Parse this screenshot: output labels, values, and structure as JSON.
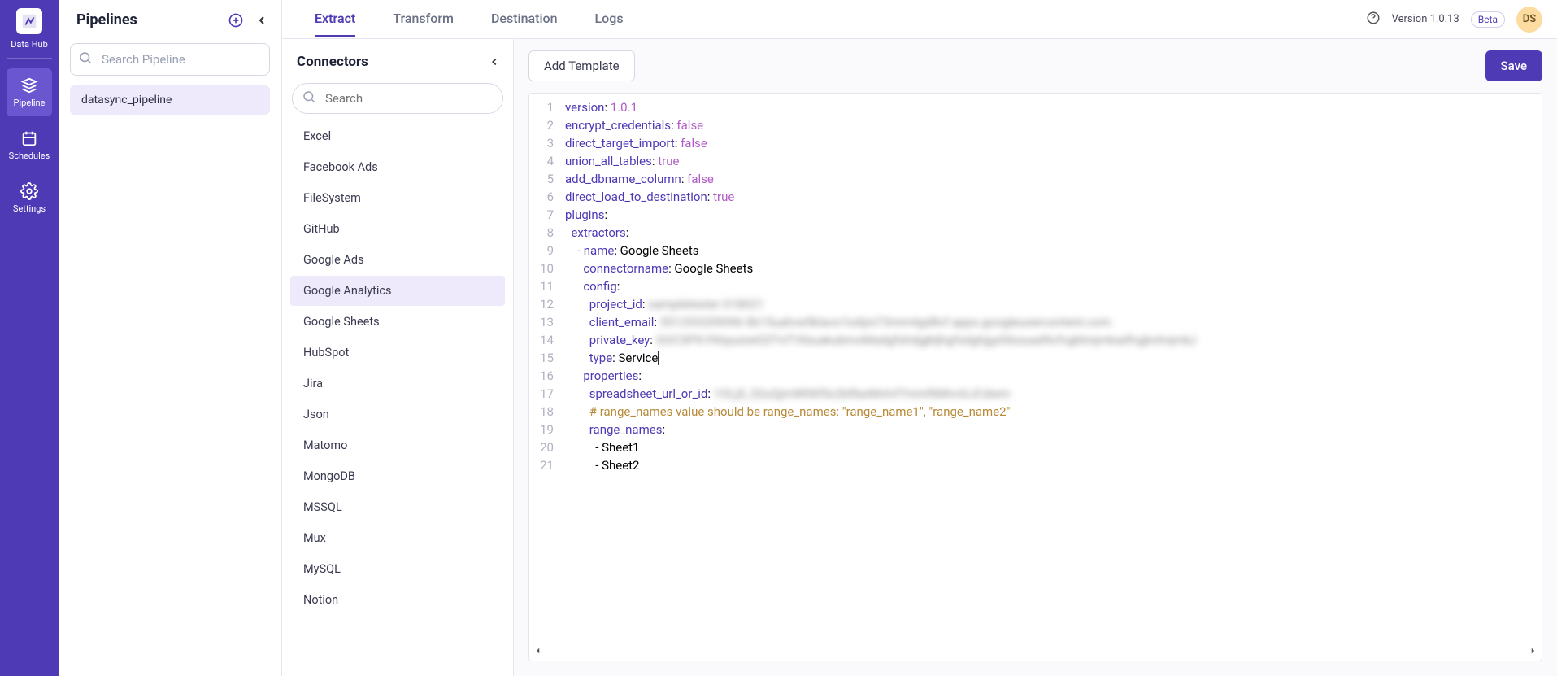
{
  "brand": {
    "label": "Data Hub"
  },
  "nav": {
    "items": [
      {
        "label": "Pipeline",
        "active": true
      },
      {
        "label": "Schedules",
        "active": false
      },
      {
        "label": "Settings",
        "active": false
      }
    ]
  },
  "pipelines": {
    "title": "Pipelines",
    "search_placeholder": "Search Pipeline",
    "items": [
      {
        "name": "datasync_pipeline"
      }
    ]
  },
  "tabs": [
    {
      "label": "Extract",
      "active": true
    },
    {
      "label": "Transform",
      "active": false
    },
    {
      "label": "Destination",
      "active": false
    },
    {
      "label": "Logs",
      "active": false
    }
  ],
  "header": {
    "version": "Version 1.0.13",
    "beta": "Beta",
    "avatar": "DS"
  },
  "connectors": {
    "title": "Connectors",
    "search_placeholder": "Search",
    "items": [
      {
        "name": "Excel"
      },
      {
        "name": "Facebook Ads"
      },
      {
        "name": "FileSystem"
      },
      {
        "name": "GitHub"
      },
      {
        "name": "Google Ads"
      },
      {
        "name": "Google Analytics",
        "selected": true
      },
      {
        "name": "Google Sheets"
      },
      {
        "name": "HubSpot"
      },
      {
        "name": "Jira"
      },
      {
        "name": "Json"
      },
      {
        "name": "Matomo"
      },
      {
        "name": "MongoDB"
      },
      {
        "name": "MSSQL"
      },
      {
        "name": "Mux"
      },
      {
        "name": "MySQL"
      },
      {
        "name": "Notion"
      }
    ]
  },
  "editor_toolbar": {
    "add_template": "Add Template",
    "save": "Save"
  },
  "code": {
    "lines": [
      {
        "n": 1,
        "segments": [
          {
            "t": "version",
            "c": "k"
          },
          {
            "t": ": "
          },
          {
            "t": "1.0.1",
            "c": "n"
          }
        ]
      },
      {
        "n": 2,
        "segments": [
          {
            "t": "encrypt_credentials",
            "c": "k"
          },
          {
            "t": ": "
          },
          {
            "t": "false",
            "c": "n"
          }
        ]
      },
      {
        "n": 3,
        "segments": [
          {
            "t": "direct_target_import",
            "c": "k"
          },
          {
            "t": ": "
          },
          {
            "t": "false",
            "c": "n"
          }
        ]
      },
      {
        "n": 4,
        "segments": [
          {
            "t": "union_all_tables",
            "c": "k"
          },
          {
            "t": ": "
          },
          {
            "t": "true",
            "c": "n"
          }
        ]
      },
      {
        "n": 5,
        "segments": [
          {
            "t": "add_dbname_column",
            "c": "k"
          },
          {
            "t": ": "
          },
          {
            "t": "false",
            "c": "n"
          }
        ]
      },
      {
        "n": 6,
        "segments": [
          {
            "t": "direct_load_to_destination",
            "c": "k"
          },
          {
            "t": ": "
          },
          {
            "t": "true",
            "c": "n"
          }
        ]
      },
      {
        "n": 7,
        "segments": [
          {
            "t": "plugins",
            "c": "k"
          },
          {
            "t": ":"
          }
        ]
      },
      {
        "n": 8,
        "segments": [
          {
            "t": "  "
          },
          {
            "t": "extractors",
            "c": "k"
          },
          {
            "t": ":"
          }
        ]
      },
      {
        "n": 9,
        "segments": [
          {
            "t": "    - "
          },
          {
            "t": "name",
            "c": "k"
          },
          {
            "t": ": Google Sheets"
          }
        ]
      },
      {
        "n": 10,
        "segments": [
          {
            "t": "      "
          },
          {
            "t": "connectorname",
            "c": "k"
          },
          {
            "t": ": Google Sheets"
          }
        ]
      },
      {
        "n": 11,
        "segments": [
          {
            "t": "      "
          },
          {
            "t": "config",
            "c": "k"
          },
          {
            "t": ":"
          }
        ]
      },
      {
        "n": 12,
        "segments": [
          {
            "t": "        "
          },
          {
            "t": "project_id",
            "c": "k"
          },
          {
            "t": ": "
          },
          {
            "t": "sampletester-318021",
            "c": "blur"
          }
        ]
      },
      {
        "n": 13,
        "segments": [
          {
            "t": "        "
          },
          {
            "t": "client_email",
            "c": "k"
          },
          {
            "t": ": "
          },
          {
            "t": "551293209096-5b15uahve5klavs1iu6jni73mm4gd8vf.apps.googleusercontent.com",
            "c": "blur"
          }
        ]
      },
      {
        "n": 14,
        "segments": [
          {
            "t": "        "
          },
          {
            "t": "private_key",
            "c": "k"
          },
          {
            "t": ": "
          },
          {
            "t": "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gfshdgjkljhgfsdghjgsfdssuad9cfvgbhnjmkadfvgbvhnjmk,l",
            "c": "blur"
          }
        ]
      },
      {
        "n": 15,
        "segments": [
          {
            "t": "        "
          },
          {
            "t": "type",
            "c": "k"
          },
          {
            "t": ": Service",
            "cursor": true
          }
        ]
      },
      {
        "n": 16,
        "segments": [
          {
            "t": "      "
          },
          {
            "t": "properties",
            "c": "k"
          },
          {
            "t": ":"
          }
        ]
      },
      {
        "n": 17,
        "segments": [
          {
            "t": "        "
          },
          {
            "t": "spreadsheet_url_or_id",
            "c": "k"
          },
          {
            "t": ": "
          },
          {
            "t": "1OLj0_52uQjmW06f5o2bflaxMvlvf7mmf6MvvGJCdwm",
            "c": "blur"
          }
        ]
      },
      {
        "n": 18,
        "segments": [
          {
            "t": "        "
          },
          {
            "t": "# range_names value should be range_names: \"range_name1\", \"range_name2\"",
            "c": "c"
          }
        ]
      },
      {
        "n": 19,
        "segments": [
          {
            "t": "        "
          },
          {
            "t": "range_names",
            "c": "k"
          },
          {
            "t": ":"
          }
        ]
      },
      {
        "n": 20,
        "segments": [
          {
            "t": "          - Sheet1"
          }
        ]
      },
      {
        "n": 21,
        "segments": [
          {
            "t": "          - Sheet2"
          }
        ]
      }
    ]
  }
}
